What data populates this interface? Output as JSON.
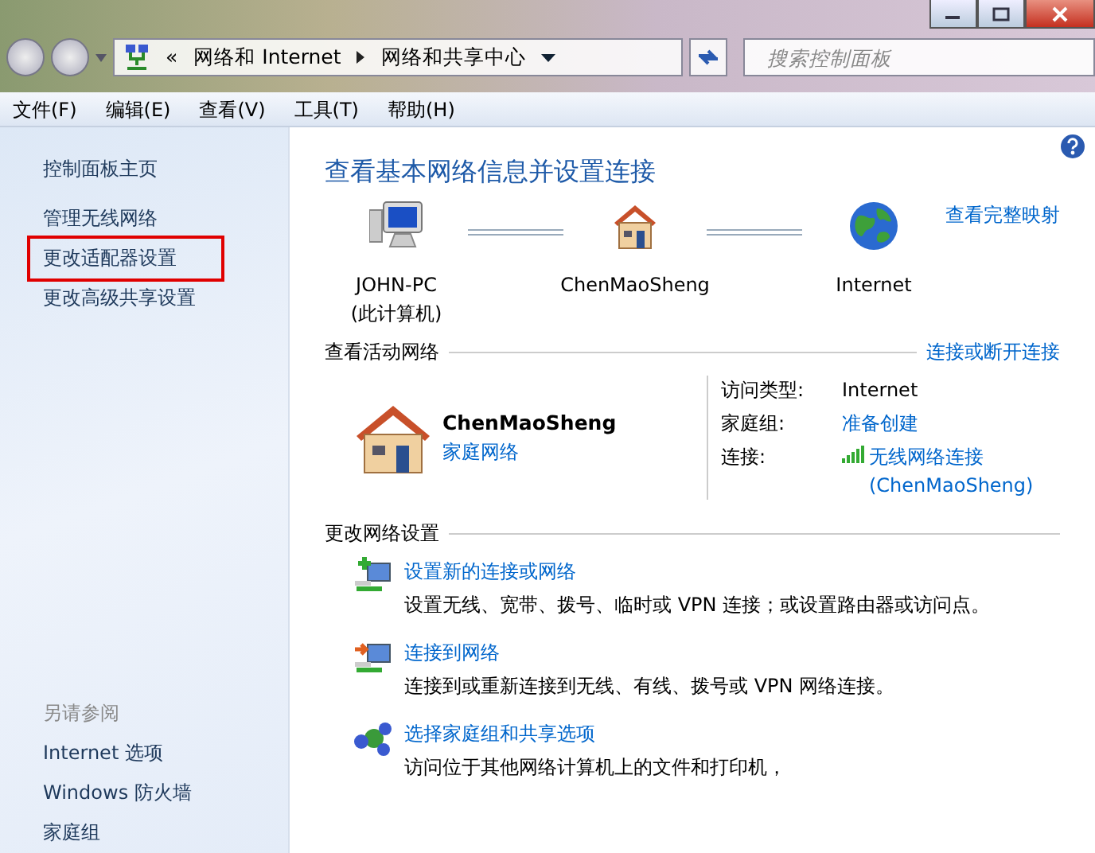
{
  "address_bar": {
    "crumbs": [
      "«",
      "网络和 Internet",
      "网络和共享中心"
    ]
  },
  "search": {
    "placeholder": "搜索控制面板"
  },
  "menu": [
    "文件(F)",
    "编辑(E)",
    "查看(V)",
    "工具(T)",
    "帮助(H)"
  ],
  "sidebar": {
    "home": "控制面板主页",
    "tasks": [
      {
        "label": "管理无线网络",
        "highlighted": false
      },
      {
        "label": "更改适配器设置",
        "highlighted": true
      },
      {
        "label": "更改高级共享设置",
        "highlighted": false
      }
    ],
    "see_also": {
      "title": "另请参阅",
      "items": [
        "Internet 选项",
        "Windows 防火墙",
        "家庭组"
      ]
    }
  },
  "main": {
    "title": "查看基本网络信息并设置连接",
    "map": {
      "nodes": [
        {
          "kind": "computer",
          "label": "JOHN-PC",
          "sublabel": "(此计算机)"
        },
        {
          "kind": "house",
          "label": "ChenMaoSheng"
        },
        {
          "kind": "globe",
          "label": "Internet"
        }
      ],
      "link": "查看完整映射"
    },
    "active": {
      "header": "查看活动网络",
      "link": "连接或断开连接",
      "network": {
        "name": "ChenMaoSheng",
        "type": "家庭网络"
      },
      "props": [
        {
          "label": "访问类型:",
          "kind": "text",
          "value": "Internet"
        },
        {
          "label": "家庭组:",
          "kind": "link",
          "value": "准备创建"
        },
        {
          "label": "连接:",
          "kind": "signal",
          "value": "无线网络连接",
          "value2": "(ChenMaoSheng)"
        }
      ]
    },
    "change": {
      "header": "更改网络设置",
      "tasks": [
        {
          "kind": "add",
          "title": "设置新的连接或网络",
          "description": "设置无线、宽带、拨号、临时或 VPN 连接；或设置路由器或访问点。"
        },
        {
          "kind": "connect",
          "title": "连接到网络",
          "description": "连接到或重新连接到无线、有线、拨号或 VPN 网络连接。"
        },
        {
          "kind": "share",
          "title": "选择家庭组和共享选项",
          "description": "访问位于其他网络计算机上的文件和打印机，"
        }
      ]
    }
  }
}
